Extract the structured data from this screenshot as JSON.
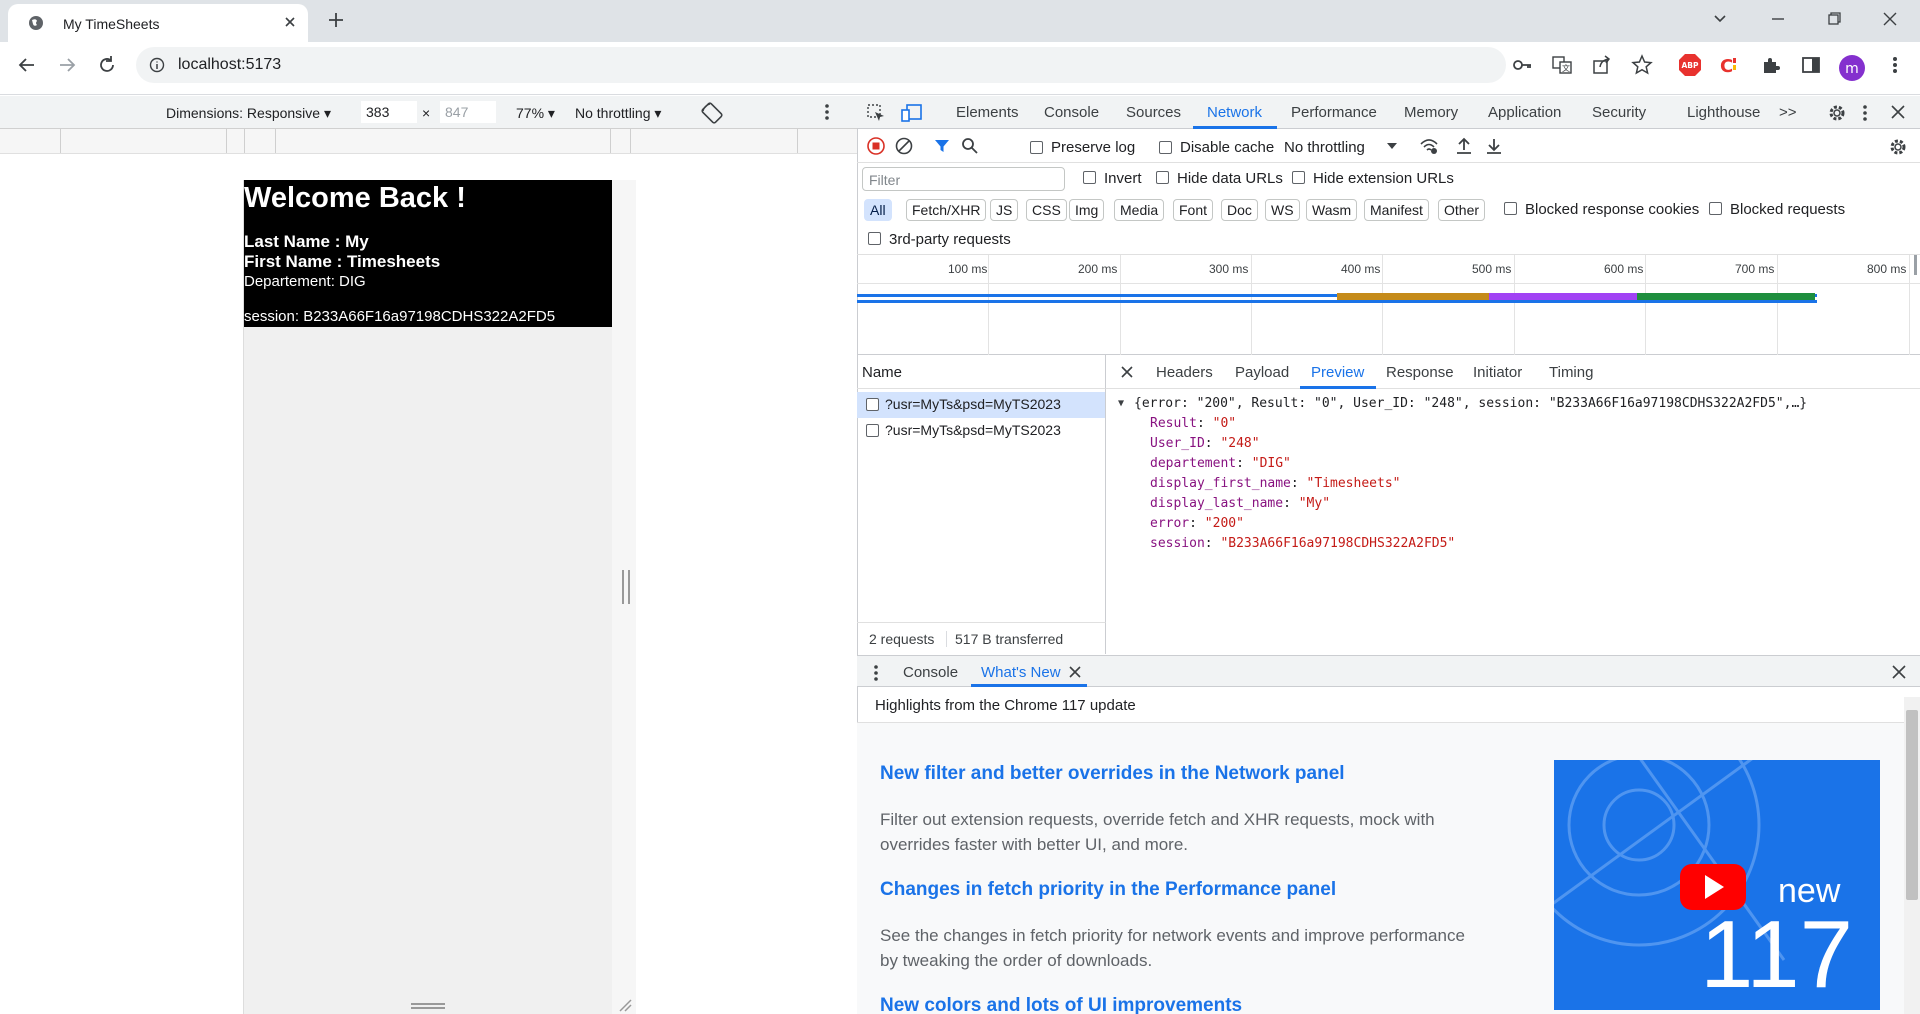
{
  "browser": {
    "tab_title": "My TimeSheets",
    "url": "localhost:5173",
    "profile_initial": "m",
    "extension_badge": "ABP"
  },
  "device_toolbar": {
    "dimensions_label": "Dimensions: Responsive",
    "width": "383",
    "times": "×",
    "height": "847",
    "zoom": "77%",
    "throttling": "No throttling"
  },
  "page": {
    "heading": "Welcome Back !",
    "last_name_line": "Last Name : My",
    "first_name_line": "First Name : Timesheets",
    "department_line": "Departement: DIG",
    "session_line": "session: B233A66F16a97198CDHS322A2FD5"
  },
  "devtools": {
    "tabs": [
      "Elements",
      "Console",
      "Sources",
      "Network",
      "Performance",
      "Memory",
      "Application",
      "Security",
      "Lighthouse"
    ],
    "more_tabs": ">>",
    "network": {
      "preserve_log": "Preserve log",
      "disable_cache": "Disable cache",
      "throttling": "No throttling",
      "filter_placeholder": "Filter",
      "invert": "Invert",
      "hide_data_urls": "Hide data URLs",
      "hide_extension_urls": "Hide extension URLs",
      "type_filters": [
        "All",
        "Fetch/XHR",
        "JS",
        "CSS",
        "Img",
        "Media",
        "Font",
        "Doc",
        "WS",
        "Wasm",
        "Manifest",
        "Other"
      ],
      "blocked_response_cookies": "Blocked response cookies",
      "blocked_requests": "Blocked requests",
      "third_party": "3rd-party requests",
      "timeline_ticks": [
        "100 ms",
        "200 ms",
        "300 ms",
        "400 ms",
        "500 ms",
        "600 ms",
        "700 ms",
        "800 ms"
      ],
      "name_header": "Name",
      "requests": [
        "?usr=MyTs&psd=MyTS2023",
        "?usr=MyTs&psd=MyTS2023"
      ],
      "footer_requests": "2 requests",
      "footer_transferred": "517 B transferred",
      "detail_tabs": [
        "Headers",
        "Payload",
        "Preview",
        "Response",
        "Initiator",
        "Timing"
      ],
      "preview_summary": "{error: \"200\", Result: \"0\", User_ID: \"248\", session: \"B233A66F16a97198CDHS322A2FD5\",…}",
      "preview_props": [
        {
          "key": "Result",
          "value": "\"0\""
        },
        {
          "key": "User_ID",
          "value": "\"248\""
        },
        {
          "key": "departement",
          "value": "\"DIG\""
        },
        {
          "key": "display_first_name",
          "value": "\"Timesheets\""
        },
        {
          "key": "display_last_name",
          "value": "\"My\""
        },
        {
          "key": "error",
          "value": "\"200\""
        },
        {
          "key": "session",
          "value": "\"B233A66F16a97198CDHS322A2FD5\""
        }
      ]
    },
    "drawer": {
      "tabs": [
        "Console",
        "What's New"
      ],
      "whats_new_header": "Highlights from the Chrome 117 update",
      "items": [
        {
          "title": "New filter and better overrides in the Network panel",
          "desc": "Filter out extension requests, override fetch and XHR requests, mock with overrides faster with better UI, and more."
        },
        {
          "title": "Changes in fetch priority in the Performance panel",
          "desc": "See the changes in fetch priority for network events and improve performance by tweaking the order of downloads."
        },
        {
          "title": "New colors and lots of UI improvements",
          "desc": ""
        }
      ],
      "video_label_word": "new",
      "video_label_version": "117"
    }
  },
  "colors": {
    "accent": "#1a73e8",
    "timeline_blue": "#1a73e8",
    "timeline_orange": "#c58b1a",
    "timeline_purple": "#a142f4",
    "timeline_green": "#1e8e3e",
    "record_red": "#d93025",
    "profile_purple": "#8430ce"
  }
}
